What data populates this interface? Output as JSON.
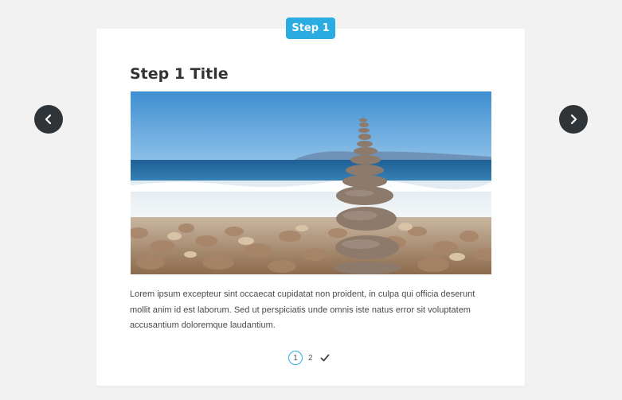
{
  "badge": {
    "label": "Step 1"
  },
  "step": {
    "title": "Step 1 Title",
    "body": "Lorem ipsum excepteur sint occaecat cupidatat non proident, in culpa qui officia deserunt mollit anim id est laborum. Sed ut perspiciatis unde omnis iste natus error sit voluptatem accusantium doloremque laudantium.",
    "image": "stacked-stones-beach-photo"
  },
  "pager": {
    "current": "1",
    "next": "2",
    "final_icon": "checkmark-icon"
  },
  "nav": {
    "prev_icon": "chevron-left-icon",
    "next_icon": "chevron-right-icon"
  },
  "colors": {
    "accent": "#2aace2",
    "nav_bg": "#2f3438",
    "page_bg": "#f2f2f2",
    "card_bg": "#ffffff"
  }
}
